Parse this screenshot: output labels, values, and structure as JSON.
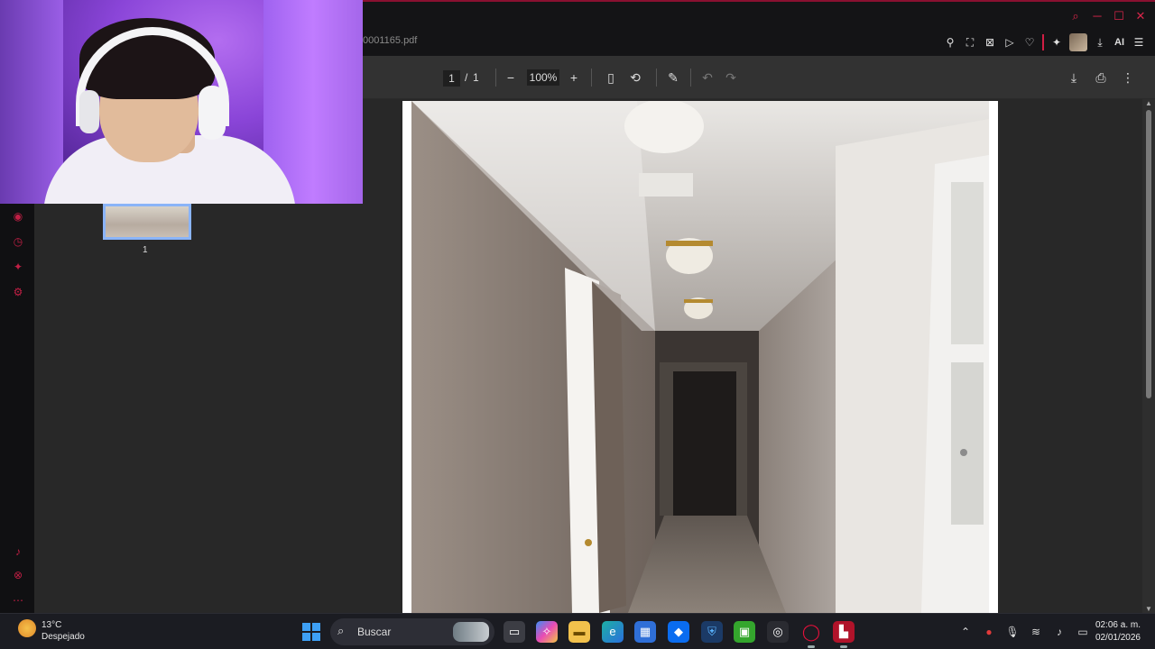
{
  "document": {
    "filename": "0001165.pdf"
  },
  "pdf_toolbar": {
    "page_current": "1",
    "page_separator": "/",
    "page_total": "1",
    "zoom": "100%",
    "zoom_out_icon": "minus-icon",
    "zoom_in_icon": "plus-icon"
  },
  "thumbnails": [
    {
      "label": "1"
    }
  ],
  "topbar_tools": {
    "ai_label": "AI"
  },
  "taskbar": {
    "weather_temp": "13°C",
    "weather_desc": "Despejado",
    "search_placeholder": "Buscar",
    "time": "02:06 a. m.",
    "date": "02/01/2026"
  },
  "colors": {
    "accent": "#d01e44",
    "toolbar": "#323232",
    "sidebar": "#282828",
    "taskbar": "#1b1c22",
    "thumb_border": "#8ab4f8"
  }
}
